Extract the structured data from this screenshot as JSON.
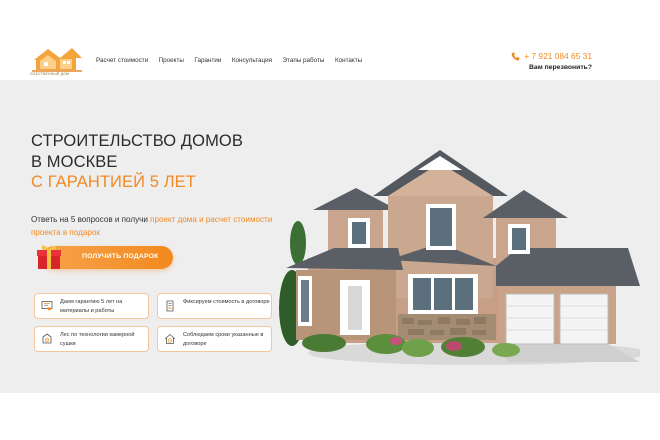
{
  "header": {
    "logo_caption": "СОБСТВЕННЫЙ ДОМ",
    "nav": [
      {
        "label": "Расчет стоимости"
      },
      {
        "label": "Проекты"
      },
      {
        "label": "Гарантии"
      },
      {
        "label": "Консультация"
      },
      {
        "label": "Этапы работы"
      },
      {
        "label": "Контакты"
      }
    ],
    "phone": "+ 7 921 084 65 31",
    "callback": "Вам перезвонить?"
  },
  "hero": {
    "title_line1": "СТРОИТЕЛЬСТВО ДОМОВ",
    "title_line2": "В МОСКВЕ",
    "title_line3": "С ГАРАНТИЕЙ 5 ЛЕТ",
    "subtitle_plain": "Ответь на  5 вопросов  и получи ",
    "subtitle_accent": "проект дома и расчет стоимости проекта в подарок",
    "cta_label": "ПОЛУЧИТЬ ПОДАРОК",
    "features": [
      {
        "text": "Даем гарантию 5 лет на материалы и работы",
        "icon": "certificate-icon"
      },
      {
        "text": "Фиксируем стоимость в договоре",
        "icon": "contract-icon"
      },
      {
        "text": "Лес по технологии камерной сушки",
        "icon": "wood-icon"
      },
      {
        "text": "Соблюдаем сроки указанные в договоре",
        "icon": "house-clock-icon"
      }
    ]
  },
  "colors": {
    "accent": "#f08a24",
    "hero_background": "#eeeeee",
    "text": "#2b2b2b"
  }
}
